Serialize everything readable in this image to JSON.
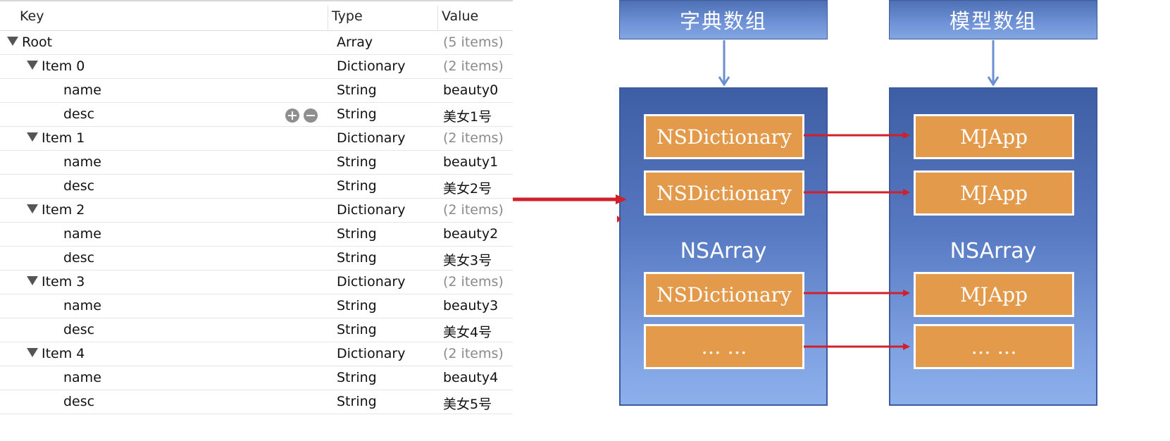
{
  "plist": {
    "headers": {
      "key": "Key",
      "type": "Type",
      "value": "Value"
    },
    "rows": [
      {
        "level": 0,
        "expand": true,
        "key": "Root",
        "type": "Array",
        "value": "(5 items)",
        "muted": true
      },
      {
        "level": 1,
        "expand": true,
        "key": "Item 0",
        "type": "Dictionary",
        "value": "(2 items)",
        "muted": true
      },
      {
        "level": 2,
        "expand": false,
        "key": "name",
        "type": "String",
        "value": "beauty0"
      },
      {
        "level": 2,
        "expand": false,
        "key": "desc",
        "type": "String",
        "value": "美女1号",
        "controls": true
      },
      {
        "level": 1,
        "expand": true,
        "key": "Item 1",
        "type": "Dictionary",
        "value": "(2 items)",
        "muted": true
      },
      {
        "level": 2,
        "expand": false,
        "key": "name",
        "type": "String",
        "value": "beauty1"
      },
      {
        "level": 2,
        "expand": false,
        "key": "desc",
        "type": "String",
        "value": "美女2号"
      },
      {
        "level": 1,
        "expand": true,
        "key": "Item 2",
        "type": "Dictionary",
        "value": "(2 items)",
        "muted": true
      },
      {
        "level": 2,
        "expand": false,
        "key": "name",
        "type": "String",
        "value": "beauty2"
      },
      {
        "level": 2,
        "expand": false,
        "key": "desc",
        "type": "String",
        "value": "美女3号"
      },
      {
        "level": 1,
        "expand": true,
        "key": "Item 3",
        "type": "Dictionary",
        "value": "(2 items)",
        "muted": true
      },
      {
        "level": 2,
        "expand": false,
        "key": "name",
        "type": "String",
        "value": "beauty3"
      },
      {
        "level": 2,
        "expand": false,
        "key": "desc",
        "type": "String",
        "value": "美女4号"
      },
      {
        "level": 1,
        "expand": true,
        "key": "Item 4",
        "type": "Dictionary",
        "value": "(2 items)",
        "muted": true
      },
      {
        "level": 2,
        "expand": false,
        "key": "name",
        "type": "String",
        "value": "beauty4"
      },
      {
        "level": 2,
        "expand": false,
        "key": "desc",
        "type": "String",
        "value": "美女5号"
      }
    ]
  },
  "diagram": {
    "left": {
      "header": "字典数组",
      "container": "NSArray",
      "items": [
        "NSDictionary",
        "NSDictionary",
        "NSDictionary",
        "… …"
      ]
    },
    "right": {
      "header": "模型数组",
      "container": "NSArray",
      "items": [
        "MJApp",
        "MJApp",
        "MJApp",
        "… …"
      ]
    },
    "colors": {
      "blue_header": "#5f82c8",
      "blue_column": "#5779c2",
      "orange_box": "#e39a4b",
      "arrow_red": "#d0202a",
      "arrow_blue": "#6b8fd0"
    }
  }
}
